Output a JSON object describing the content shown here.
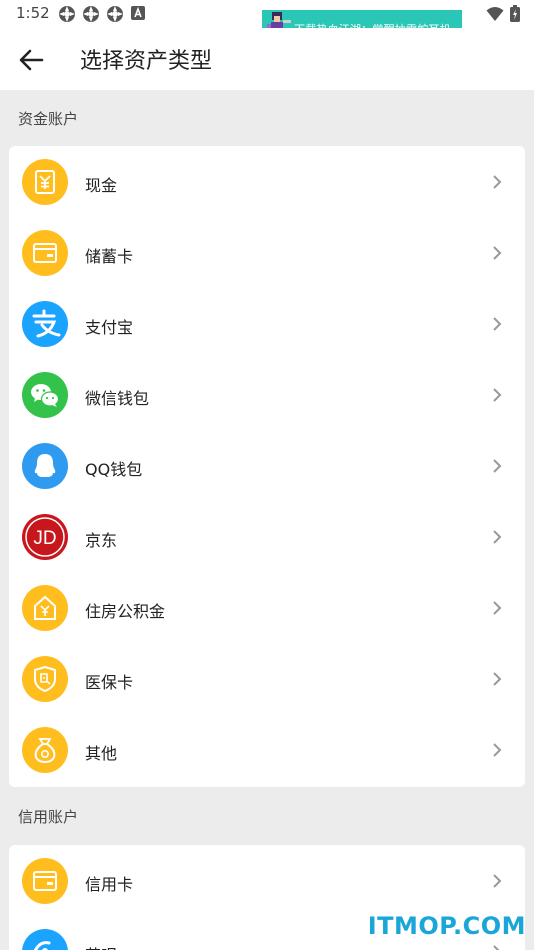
{
  "status_bar": {
    "time": "1:52"
  },
  "ad": {
    "text": "下载热血江湖：觉醒抽雷蛇耳机"
  },
  "header": {
    "title": "选择资产类型"
  },
  "sections": [
    {
      "title": "资金账户",
      "items": [
        {
          "label": "现金",
          "icon": "cash-icon",
          "color": "#ffbe1e"
        },
        {
          "label": "储蓄卡",
          "icon": "debit-card-icon",
          "color": "#ffbe1e"
        },
        {
          "label": "支付宝",
          "icon": "alipay-icon",
          "color": "#1aa3ff"
        },
        {
          "label": "微信钱包",
          "icon": "wechat-icon",
          "color": "#33c24a"
        },
        {
          "label": "QQ钱包",
          "icon": "qq-icon",
          "color": "#2f9bf0"
        },
        {
          "label": "京东",
          "icon": "jd-icon",
          "color": "#e1251b"
        },
        {
          "label": "住房公积金",
          "icon": "housing-fund-icon",
          "color": "#ffbe1e"
        },
        {
          "label": "医保卡",
          "icon": "medical-insurance-icon",
          "color": "#ffbe1e"
        },
        {
          "label": "其他",
          "icon": "money-bag-icon",
          "color": "#ffbe1e"
        }
      ]
    },
    {
      "title": "信用账户",
      "items": [
        {
          "label": "信用卡",
          "icon": "credit-card-icon",
          "color": "#ffbe1e"
        },
        {
          "label": "花呗",
          "icon": "huabei-icon",
          "color": "#1aa3ff"
        }
      ]
    }
  ],
  "watermark": {
    "text": "ITMOP.COM"
  }
}
